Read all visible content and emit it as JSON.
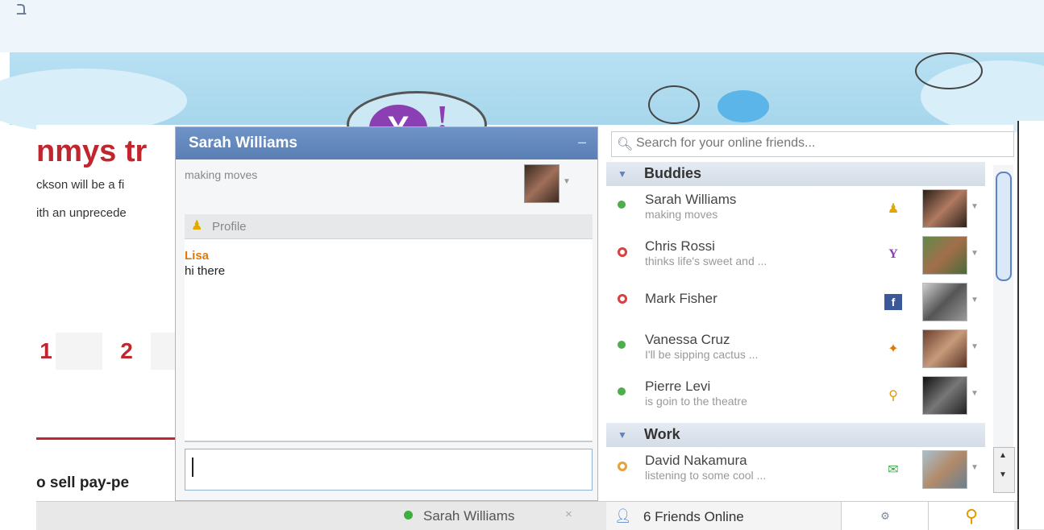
{
  "page": {
    "top_fragment": "ב",
    "article": {
      "headline": "nmys tr",
      "line1": "ckson will be a fi",
      "line2": "ith an unprecede",
      "pager": [
        "1",
        "2"
      ],
      "footer_text": "o sell pay-pe"
    }
  },
  "chat": {
    "name": "Sarah Williams",
    "minimize": "–",
    "status": "making moves",
    "profile_label": "Profile",
    "messages": [
      {
        "from": "Lisa",
        "text": "hi there"
      }
    ],
    "tab_name": "Sarah Williams",
    "tab_close": "×"
  },
  "friends": {
    "search_placeholder": "Search for your online friends...",
    "groups": [
      {
        "name": "Buddies"
      },
      {
        "name": "Work"
      }
    ],
    "list": [
      {
        "name": "Sarah Williams",
        "status": "making moves",
        "presence": "#4cae4c",
        "network_icon": "aim-icon"
      },
      {
        "name": "Chris Rossi",
        "status": "thinks life's sweet and ...",
        "presence": "#d94040",
        "network_icon": "yahoo-icon"
      },
      {
        "name": "Mark Fisher",
        "status": "",
        "presence": "#d94040",
        "network_icon": "facebook-icon"
      },
      {
        "name": "Vanessa Cruz",
        "status": "I'll be sipping cactus ...",
        "presence": "#4cae4c",
        "network_icon": "msn-icon"
      },
      {
        "name": "Pierre Levi",
        "status": "is goin to the theatre",
        "presence": "#4cae4c",
        "network_icon": "foursquare-pin-icon"
      },
      {
        "name": "David Nakamura",
        "status": "listening to some cool ...",
        "presence": "#e6a23c",
        "network_icon": "gtalk-icon"
      }
    ],
    "online_count": "6 Friends Online"
  },
  "colors": {
    "accent": "#5a7fb6",
    "brand_red": "#c0262e",
    "yahoo_purple": "#8a3fb2"
  }
}
